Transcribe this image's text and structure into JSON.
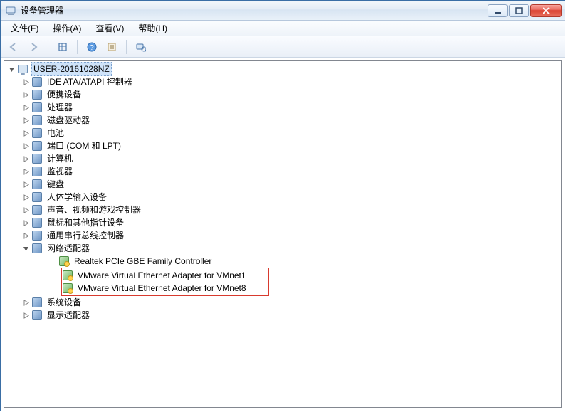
{
  "window": {
    "title": "设备管理器"
  },
  "menu": {
    "file": "文件(F)",
    "action": "操作(A)",
    "view": "查看(V)",
    "help": "帮助(H)"
  },
  "toolbar_icons": {
    "back": "back-arrow-icon",
    "forward": "forward-arrow-icon",
    "show_hidden": "show-hidden-icon",
    "help": "help-icon",
    "properties": "properties-icon",
    "scan": "scan-icon"
  },
  "tree": {
    "root": {
      "label": "USER-20161028NZ",
      "expanded": true
    },
    "categories": [
      {
        "label": "IDE ATA/ATAPI 控制器",
        "expanded": false
      },
      {
        "label": "便携设备",
        "expanded": false
      },
      {
        "label": "处理器",
        "expanded": false
      },
      {
        "label": "磁盘驱动器",
        "expanded": false
      },
      {
        "label": "电池",
        "expanded": false
      },
      {
        "label": "端口 (COM 和 LPT)",
        "expanded": false
      },
      {
        "label": "计算机",
        "expanded": false
      },
      {
        "label": "监视器",
        "expanded": false
      },
      {
        "label": "键盘",
        "expanded": false
      },
      {
        "label": "人体学输入设备",
        "expanded": false
      },
      {
        "label": "声音、视频和游戏控制器",
        "expanded": false
      },
      {
        "label": "鼠标和其他指针设备",
        "expanded": false
      },
      {
        "label": "通用串行总线控制器",
        "expanded": false
      },
      {
        "label": "网络适配器",
        "expanded": true,
        "children": [
          {
            "label": "Realtek PCIe GBE Family Controller"
          },
          {
            "label": "VMware Virtual Ethernet Adapter for VMnet1",
            "highlighted": true
          },
          {
            "label": "VMware Virtual Ethernet Adapter for VMnet8",
            "highlighted": true
          }
        ]
      },
      {
        "label": "系统设备",
        "expanded": false
      },
      {
        "label": "显示适配器",
        "expanded": false
      }
    ]
  }
}
